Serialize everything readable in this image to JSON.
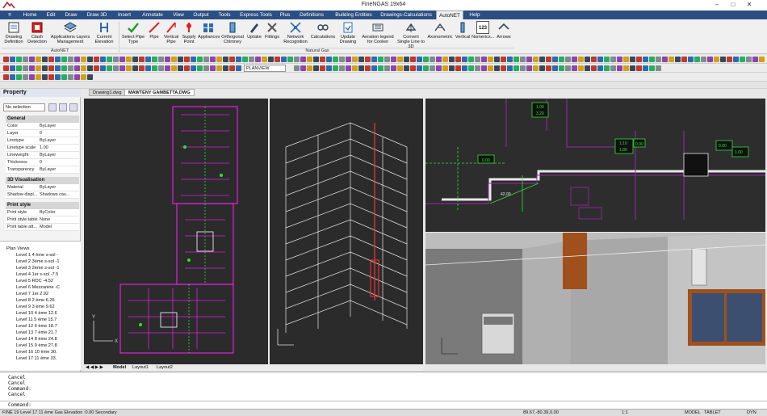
{
  "window": {
    "title": "FineNGAS 19x64"
  },
  "menu_tabs": [
    "Home",
    "Edit",
    "Draw",
    "Draw 3D",
    "Insert",
    "Annotate",
    "View",
    "Output",
    "Tools",
    "Express Tools",
    "Plus",
    "Definitions",
    "Building Entities",
    "Drawings-Calculations",
    "AutoNET",
    "Help"
  ],
  "active_tab": "AutoNET",
  "ribbon": {
    "buttons": [
      {
        "label": "Drawing Definition",
        "icon": "drawing-definition-icon"
      },
      {
        "label": "Clash Detection",
        "icon": "clash-detection-icon"
      },
      {
        "label": "Applications Layers Management",
        "icon": "layers-icon"
      },
      {
        "label": "Current Elevation",
        "icon": "elevation-icon"
      },
      {
        "label": "Select Pipe Type",
        "icon": "checkmark-icon"
      },
      {
        "label": "Pipe",
        "icon": "pipe-icon"
      },
      {
        "label": "Vertical Pipe",
        "icon": "vertical-pipe-icon"
      },
      {
        "label": "Supply Point",
        "icon": "supply-point-icon"
      },
      {
        "label": "Appliances",
        "icon": "appliances-icon"
      },
      {
        "label": "Orthogonal Chimney",
        "icon": "chimney-icon"
      },
      {
        "label": "Uptake",
        "icon": "uptake-icon"
      },
      {
        "label": "Fittings",
        "icon": "fittings-icon"
      },
      {
        "label": "Network Recognition",
        "icon": "network-icon"
      },
      {
        "label": "Calculations",
        "icon": "calculations-icon"
      },
      {
        "label": "Update Drawing",
        "icon": "update-drawing-icon"
      },
      {
        "label": "Aeration legend for Cooker",
        "icon": "aeration-icon"
      },
      {
        "label": "Convert Single Line to 3D",
        "icon": "convert-3d-icon"
      },
      {
        "label": "Axonometric",
        "icon": "axonometric-icon"
      },
      {
        "label": "Vertical",
        "icon": "vertical-icon"
      },
      {
        "label": "Numerics...",
        "icon": "numerics-icon"
      },
      {
        "label": "Arrows",
        "icon": "arrows-icon"
      }
    ],
    "groups": [
      "AutoNET",
      "Natural Gas"
    ],
    "numerics_badge": "123"
  },
  "view_combo": "PLANVIEW",
  "property_panel": {
    "title": "Property",
    "selection": "No selection",
    "sections": [
      {
        "name": "General",
        "rows": [
          {
            "k": "Color",
            "v": "ByLayer"
          },
          {
            "k": "Layer",
            "v": "0"
          },
          {
            "k": "Linetype",
            "v": "ByLayer"
          },
          {
            "k": "Linetype scale",
            "v": "1.00"
          },
          {
            "k": "Lineweight",
            "v": "ByLayer"
          },
          {
            "k": "Thickness",
            "v": "0"
          },
          {
            "k": "Transparency",
            "v": "ByLayer"
          }
        ]
      },
      {
        "name": "3D Visualisation",
        "rows": [
          {
            "k": "Material",
            "v": "ByLayer"
          },
          {
            "k": "Shadow displ...",
            "v": "Shadows cas..."
          }
        ]
      },
      {
        "name": "Print style",
        "rows": [
          {
            "k": "Print style",
            "v": "ByColor"
          },
          {
            "k": "Print style table",
            "v": "None"
          },
          {
            "k": "Print table att...",
            "v": "Model"
          }
        ]
      }
    ]
  },
  "tree": {
    "root": "Plan Views",
    "items": [
      "Level 1 4 ème s-sol -",
      "Level 2 3ème s-sol -1",
      "Level 3 2ème s-sol -1",
      "Level 4 1er s-sol -7.5",
      "Level 5 RDC -4.52",
      "Level 6 Mezzanine -C",
      "Level 7 1er 2.92",
      "Level 8 2 ème 6.26",
      "Level 9 3 ème 9.62",
      "Level 10 4 ème 12.6",
      "Level 11 5 ème 15.7",
      "Level 12 6 ème 18.7",
      "Level 13 7 ème 21.7",
      "Level 14 8 ème 24.8",
      "Level 15 9 ème 27.8",
      "Level 16 10 ème 30.",
      "Level 17 11 ème 33."
    ]
  },
  "doc_tabs": [
    "Drawing1.dwg",
    "MAWTENY GAMBETTA.DWG"
  ],
  "layout_tabs": [
    "Model",
    "Layout1",
    "Layout2"
  ],
  "viewport_labels": {
    "tag1": "1.00",
    "tag2": "3.20",
    "tag3": "0.00",
    "tag4": "1.10",
    "tag5": "1.80",
    "tag6": "0.00",
    "tag7": "0.00",
    "tag8": "1.00",
    "axis_x": "X",
    "axis_y": "Y",
    "pipe_label": "42.00"
  },
  "command_lines": [
    "Cancel",
    "Cancel",
    "Command:",
    "Cancel",
    "Command:"
  ],
  "status": {
    "left": "FINE 19 Level 17 11 ème Gas Elevation :0.00 Secondary",
    "coords": "89.67,-80.39,0.00",
    "scale": "1:1",
    "right_items": [
      "MODEL",
      "TABLET",
      "DYN"
    ]
  }
}
